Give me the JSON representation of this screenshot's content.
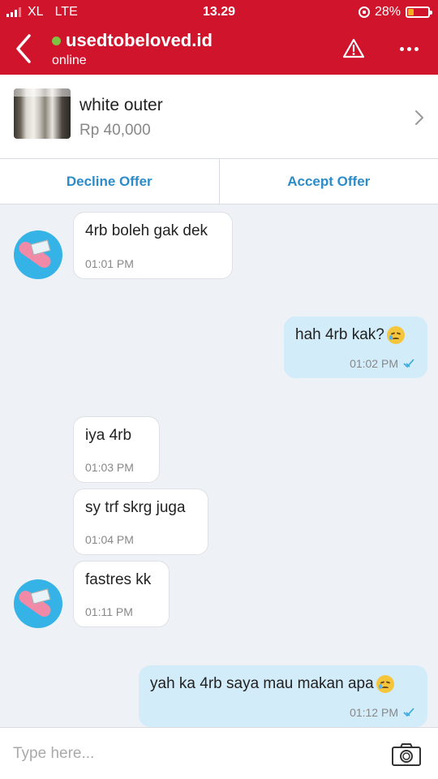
{
  "status_bar": {
    "carrier": "XL",
    "network": "LTE",
    "time": "13.29",
    "battery": "28%",
    "battery_level": 0.28
  },
  "header": {
    "username": "usedtobeloved.id",
    "presence": "online"
  },
  "product": {
    "name": "white outer",
    "price": "Rp 40,000"
  },
  "offer_actions": {
    "decline": "Decline Offer",
    "accept": "Accept Offer"
  },
  "messages": [
    {
      "direction": "in",
      "text": "4rb boleh gak dek",
      "time": "01:01 PM"
    },
    {
      "direction": "out",
      "text": "hah 4rb kak?",
      "emoji": "downcast-sweat-face",
      "time": "01:02 PM",
      "read": true
    },
    {
      "direction": "in",
      "text": "iya 4rb",
      "time": "01:03 PM"
    },
    {
      "direction": "in",
      "text": "sy trf skrg juga",
      "time": "01:04 PM"
    },
    {
      "direction": "in",
      "text": "fastres kk",
      "time": "01:11 PM"
    },
    {
      "direction": "out",
      "text": "yah ka 4rb saya mau makan apa",
      "emoji": "crying-face",
      "time": "01:12 PM",
      "read": true
    }
  ],
  "composer": {
    "placeholder": "Type here..."
  },
  "colors": {
    "header": "#d0142c",
    "accent": "#2c8cc9",
    "online": "#7fc142",
    "outgoing_bubble": "#d3ecfa",
    "background": "#eef1f5"
  }
}
